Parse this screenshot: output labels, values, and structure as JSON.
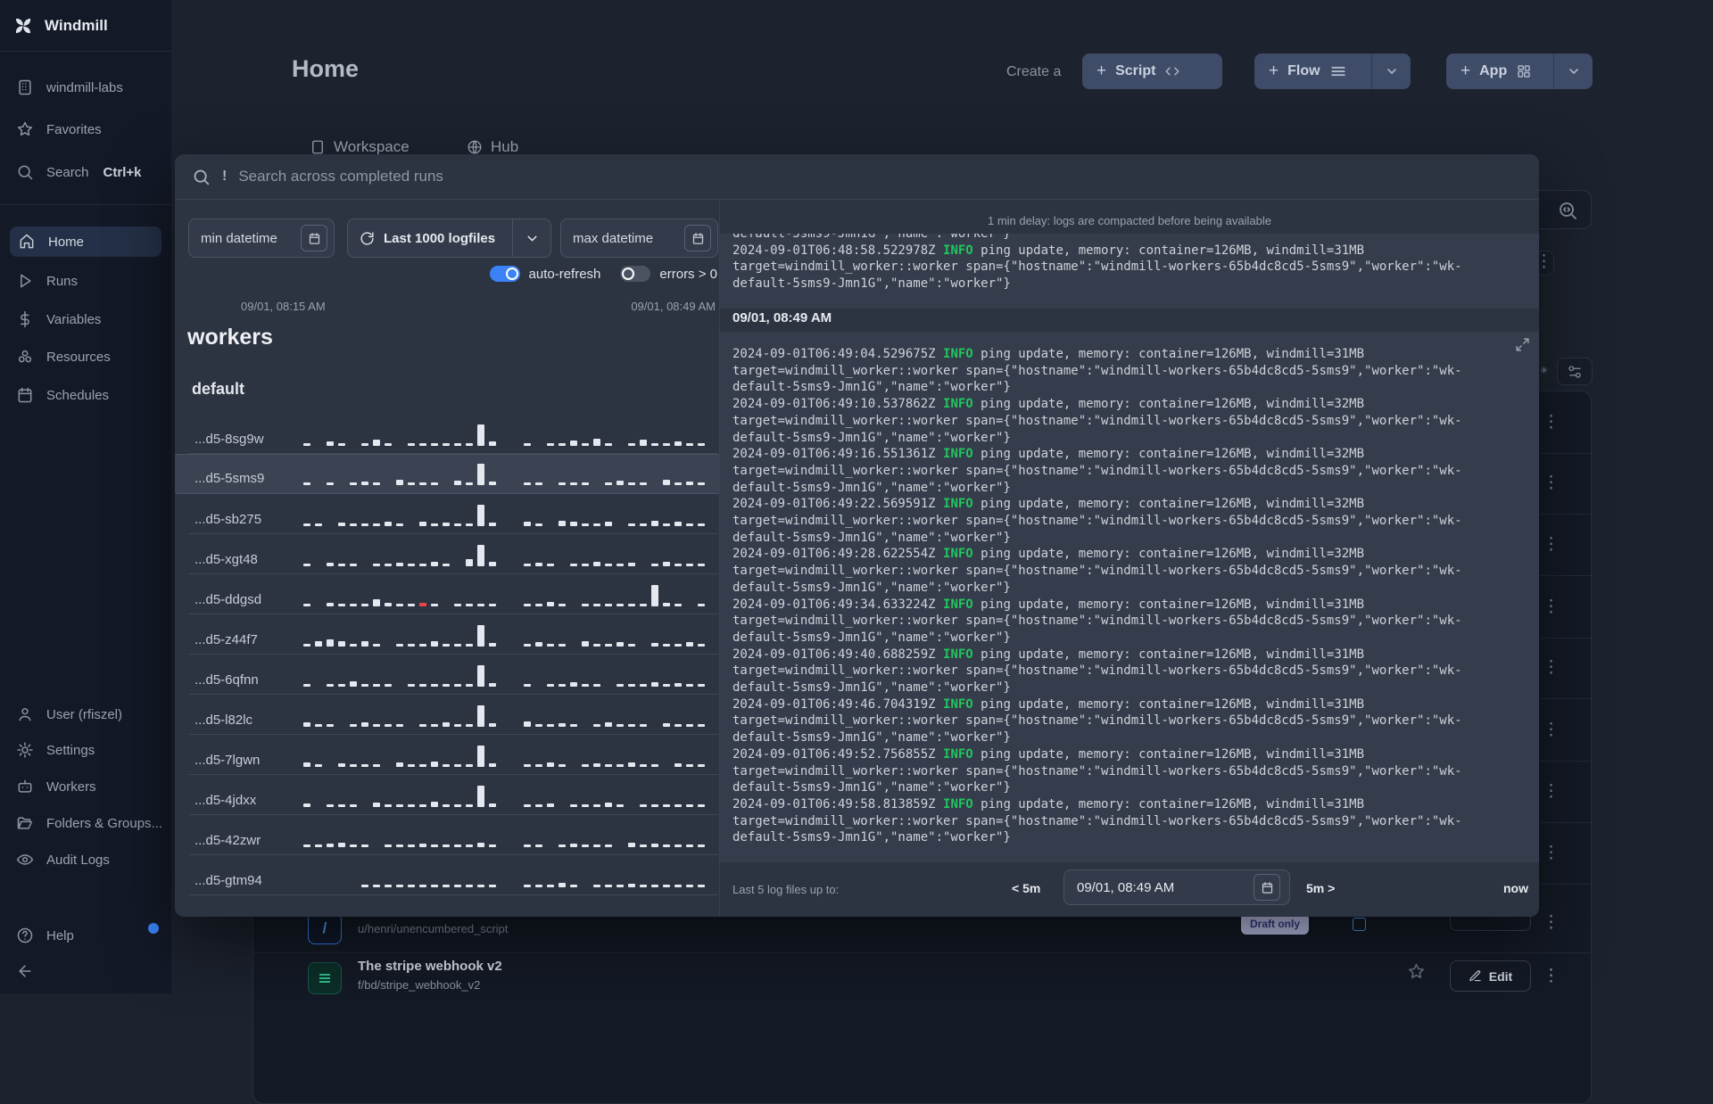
{
  "sidebar": {
    "brand": "Windmill",
    "workspace": "windmill-labs",
    "favorites": "Favorites",
    "search": "Search",
    "search_shortcut": "Ctrl+k",
    "nav": [
      "Home",
      "Runs",
      "Variables",
      "Resources",
      "Schedules"
    ],
    "bottom": [
      "User (rfiszel)",
      "Settings",
      "Workers",
      "Folders & Groups...",
      "Audit Logs"
    ],
    "help": "Help"
  },
  "header": {
    "title": "Home",
    "create_label": "Create a",
    "script": "Script",
    "flow": "Flow",
    "app": "App",
    "plus": "+"
  },
  "tabs": {
    "workspace": "Workspace",
    "hub": "Hub"
  },
  "modal": {
    "search_prefix": "!",
    "search_placeholder": "Search across completed runs",
    "filters": {
      "min": "min datetime",
      "range": "Last 1000 logfiles",
      "max": "max datetime",
      "auto_refresh": "auto-refresh",
      "errors": "errors > 0"
    },
    "time_start": "09/01, 08:15 AM",
    "time_end": "09/01, 08:49 AM",
    "workers_heading": "workers",
    "group": "default",
    "workers": [
      {
        "name": "...d5-8sg9w",
        "bars": [
          3,
          0,
          5,
          3,
          0,
          3,
          7,
          3,
          0,
          3,
          3,
          3,
          3,
          3,
          3,
          24,
          5,
          0,
          0,
          3,
          0,
          3,
          3,
          6,
          3,
          8,
          3,
          0,
          3,
          7,
          3,
          3,
          5,
          3,
          3
        ],
        "red": null,
        "selected": false
      },
      {
        "name": "...d5-5sms9",
        "bars": [
          3,
          0,
          3,
          0,
          3,
          4,
          3,
          0,
          6,
          3,
          3,
          3,
          0,
          5,
          3,
          24,
          4,
          0,
          0,
          3,
          3,
          0,
          3,
          3,
          3,
          0,
          3,
          5,
          3,
          3,
          0,
          6,
          3,
          4,
          3
        ],
        "red": null,
        "selected": true
      },
      {
        "name": "...d5-sb275",
        "bars": [
          3,
          3,
          0,
          4,
          3,
          3,
          3,
          5,
          3,
          0,
          5,
          3,
          4,
          3,
          3,
          24,
          4,
          0,
          0,
          5,
          3,
          0,
          6,
          5,
          3,
          3,
          5,
          0,
          3,
          3,
          6,
          3,
          5,
          3,
          3
        ],
        "red": null,
        "selected": false
      },
      {
        "name": "...d5-xgt48",
        "bars": [
          3,
          0,
          4,
          3,
          3,
          0,
          3,
          3,
          4,
          3,
          3,
          5,
          3,
          0,
          8,
          24,
          5,
          0,
          0,
          3,
          4,
          3,
          0,
          3,
          3,
          5,
          3,
          3,
          4,
          0,
          3,
          5,
          3,
          3,
          3
        ],
        "red": null,
        "selected": false
      },
      {
        "name": "...d5-ddgsd",
        "bars": [
          3,
          0,
          4,
          3,
          3,
          3,
          8,
          4,
          3,
          3,
          4,
          3,
          0,
          3,
          3,
          3,
          3,
          0,
          0,
          3,
          3,
          5,
          3,
          0,
          3,
          3,
          3,
          3,
          3,
          3,
          24,
          4,
          3,
          0,
          3
        ],
        "red": 10,
        "selected": false
      },
      {
        "name": "...d5-z44f7",
        "bars": [
          3,
          6,
          8,
          6,
          3,
          6,
          3,
          0,
          3,
          3,
          3,
          6,
          3,
          3,
          3,
          24,
          4,
          0,
          0,
          3,
          5,
          3,
          3,
          0,
          6,
          3,
          3,
          5,
          3,
          0,
          4,
          3,
          3,
          5,
          3
        ],
        "red": null,
        "selected": false
      },
      {
        "name": "...d5-6qfnn",
        "bars": [
          3,
          0,
          3,
          3,
          6,
          3,
          3,
          3,
          0,
          3,
          3,
          3,
          3,
          3,
          3,
          24,
          4,
          0,
          0,
          3,
          0,
          3,
          3,
          5,
          3,
          3,
          0,
          3,
          3,
          3,
          5,
          3,
          4,
          3,
          3
        ],
        "red": null,
        "selected": false
      },
      {
        "name": "...d5-l82lc",
        "bars": [
          5,
          3,
          3,
          0,
          3,
          5,
          3,
          3,
          3,
          0,
          3,
          3,
          5,
          3,
          3,
          24,
          4,
          0,
          0,
          6,
          3,
          3,
          4,
          3,
          0,
          3,
          5,
          3,
          3,
          3,
          0,
          4,
          3,
          3,
          3
        ],
        "red": null,
        "selected": false
      },
      {
        "name": "...d5-7lgwn",
        "bars": [
          5,
          3,
          0,
          4,
          3,
          3,
          3,
          0,
          5,
          3,
          3,
          6,
          3,
          3,
          3,
          24,
          4,
          0,
          0,
          3,
          3,
          5,
          3,
          0,
          3,
          4,
          3,
          3,
          5,
          3,
          3,
          0,
          4,
          3,
          3
        ],
        "red": null,
        "selected": false
      },
      {
        "name": "...d5-4jdxx",
        "bars": [
          4,
          0,
          3,
          3,
          3,
          0,
          5,
          3,
          3,
          3,
          3,
          6,
          3,
          3,
          3,
          24,
          4,
          0,
          0,
          3,
          3,
          4,
          0,
          3,
          3,
          3,
          5,
          3,
          0,
          3,
          3,
          3,
          3,
          3,
          3
        ],
        "red": null,
        "selected": false
      },
      {
        "name": "...d5-42zwr",
        "bars": [
          3,
          3,
          4,
          5,
          3,
          3,
          0,
          3,
          3,
          3,
          4,
          3,
          3,
          3,
          3,
          5,
          3,
          0,
          0,
          3,
          3,
          0,
          3,
          4,
          3,
          3,
          3,
          0,
          5,
          3,
          4,
          3,
          3,
          3,
          3
        ],
        "red": null,
        "selected": false
      },
      {
        "name": "...d5-gtm94",
        "bars": [
          0,
          0,
          0,
          0,
          0,
          3,
          3,
          3,
          3,
          3,
          3,
          3,
          3,
          3,
          3,
          3,
          3,
          0,
          0,
          3,
          3,
          3,
          5,
          3,
          0,
          3,
          3,
          3,
          4,
          3,
          3,
          3,
          3,
          3,
          3
        ],
        "red": null,
        "selected": false
      }
    ],
    "log": {
      "delay_notice": "1 min delay: logs are compacted before being available",
      "level": "INFO",
      "line1_mid": " ping update, memory: container=126MB, windmill=",
      "line2": "target=windmill_worker::worker span={\"hostname\":\"windmill-workers-65b4dc8cd5-5sms9\",\"worker\":\"wk-",
      "line3": "default-5sms9-Jmn1G\",\"name\":\"worker\"}",
      "prev_partial": "default-5sms9-Jmn1G\",\"name\":\"worker\"}",
      "prev_entry": {
        "ts": "2024-09-01T06:48:58.522978Z",
        "windmill": "31MB"
      },
      "section_header": "09/01, 08:49 AM",
      "entries": [
        {
          "ts": "2024-09-01T06:49:04.529675Z",
          "windmill": "31MB"
        },
        {
          "ts": "2024-09-01T06:49:10.537862Z",
          "windmill": "32MB"
        },
        {
          "ts": "2024-09-01T06:49:16.551361Z",
          "windmill": "32MB"
        },
        {
          "ts": "2024-09-01T06:49:22.569591Z",
          "windmill": "32MB"
        },
        {
          "ts": "2024-09-01T06:49:28.622554Z",
          "windmill": "32MB"
        },
        {
          "ts": "2024-09-01T06:49:34.633224Z",
          "windmill": "31MB"
        },
        {
          "ts": "2024-09-01T06:49:40.688259Z",
          "windmill": "31MB"
        },
        {
          "ts": "2024-09-01T06:49:46.704319Z",
          "windmill": "31MB"
        },
        {
          "ts": "2024-09-01T06:49:52.756855Z",
          "windmill": "31MB"
        },
        {
          "ts": "2024-09-01T06:49:58.813859Z",
          "windmill": "31MB"
        }
      ]
    },
    "footer": {
      "label": "Last 5 log files up to:",
      "back": "< 5m",
      "datetime": "09/01, 08:49 AM",
      "forward": "5m >",
      "now": "now"
    }
  },
  "background": {
    "row_a": {
      "path": "u/henri/unencumbered_script",
      "badge": "Draft only",
      "icon_glyph": "/"
    },
    "row_b": {
      "title": "The stripe webhook v2",
      "path": "f/bd/stripe_webhook_v2",
      "edit": "Edit"
    }
  },
  "colors": {
    "accent_blue": "#3b82f6",
    "info_green": "#22c55e",
    "error_red": "#ef4444",
    "modal_bg": "#2c3341",
    "button_bg": "#3f4c68"
  }
}
